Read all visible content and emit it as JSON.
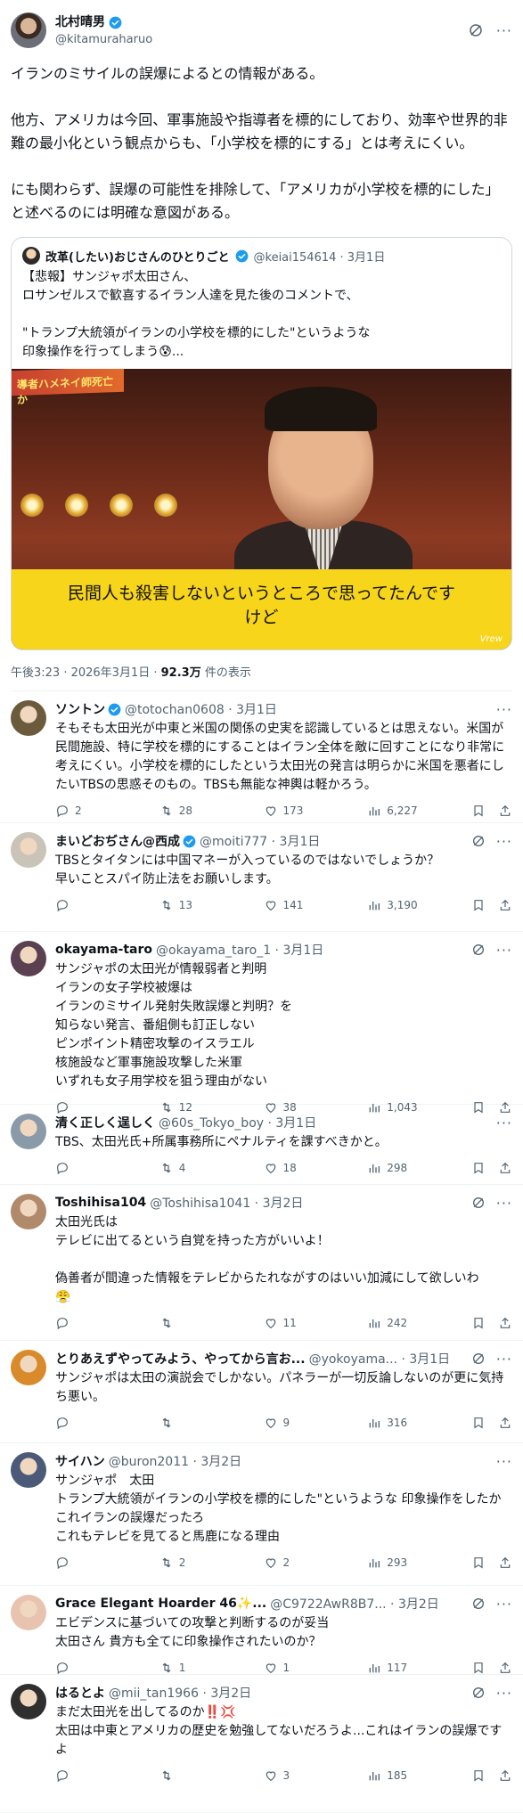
{
  "main": {
    "name": "北村晴男",
    "handle": "@kitamuraharuo",
    "text": [
      "イランのミサイルの誤爆によるとの情報がある。",
      "他方、アメリカは今回、軍事施設や指導者を標的にしており、効率や世界的非難の最小化という観点からも、「小学校を標的にする」とは考えにくい。",
      "にも関わらず、誤爆の可能性を排除して、「アメリカが小学校を標的にした」と述べるのには明確な意図がある。"
    ],
    "timestamp": "午後3:23 · 2026年3月1日 · ",
    "views": "92.3万",
    "views_label": " 件の表示"
  },
  "quote": {
    "name": "改革(したい)おじさんのひとりごと",
    "handle": "@keiai154614 · 3月1日",
    "text": "【悲報】サンジャポ太田さん、\nロサンゼルスで歓喜するイラン人達を見た後のコメントで、\n\n\"トランプ大統領がイランの小学校を標的にした\"というような\n印象操作を行ってしまう😰...",
    "banner": "導者ハメネイ師死亡か",
    "caption": "民間人も殺害しないというところで思ってたんです\nけど",
    "watermark": "Vrew"
  },
  "replies": [
    {
      "name": "ソントン",
      "meta": "@totochan0608 · 3月1日",
      "verified": true,
      "grok": false,
      "text": "そもそも太田光が中東と米国の関係の史実を認識しているとは思えない。米国が民間施設、特に学校を標的にすることはイラン全体を敵に回すことになり非常に考えにくい。小学校を標的にしたという太田光の発言は明らかに米国を悪者にしたいTBSの思惑そのもの。TBSも無能な神輿は軽かろう。",
      "replies": "2",
      "retweets": "28",
      "likes": "173",
      "views": "6,227",
      "avatar_color": "#6b5a3c"
    },
    {
      "name": "まいどおぢさん@西成",
      "meta": "@moiti777 · 3月1日",
      "verified": true,
      "grok": true,
      "text": "TBSとタイタンには中国マネーが入っているのではないでしょうか？\n早いことスパイ防止法をお願いします。",
      "replies": "",
      "retweets": "13",
      "likes": "141",
      "views": "3,190",
      "avatar_color": "#c9c3b8"
    },
    {
      "name": "okayama-taro",
      "meta": "@okayama_taro_1 · 3月1日",
      "verified": false,
      "grok": true,
      "text": "サンジャポの太田光が情報弱者と判明\nイランの女子学校被爆は\nイランのミサイル発射失敗誤爆と判明？を\n知らない発言、番組側も訂正しない\nピンポイント精密攻撃のイスラエル\n核施設など軍事施設攻撃した米軍\nいずれも女子用学校を狙う理由がない",
      "replies": "",
      "retweets": "12",
      "likes": "38",
      "views": "1,043",
      "avatar_color": "#5a4050"
    },
    {
      "name": "清く正しく逞しく",
      "meta": "@60s_Tokyo_boy · 3月1日",
      "verified": false,
      "grok": false,
      "text": "TBS、太田光氏+所属事務所にペナルティを課すべきかと。",
      "replies": "",
      "retweets": "4",
      "likes": "18",
      "views": "298",
      "avatar_color": "#8a9aa8"
    },
    {
      "name": "Toshihisa104",
      "meta": "@Toshihisa1041 · 3月2日",
      "verified": false,
      "grok": true,
      "text": "太田光氏は\nテレビに出てるという自覚を持った方がいいよ！\n\n偽善者が間違った情報をテレビからたれながすのはいい加減にして欲しいわ\n😤",
      "replies": "",
      "retweets": "",
      "likes": "11",
      "views": "242",
      "avatar_color": "#b08a6a"
    },
    {
      "name": "とりあえずやってみよう、やってから言お...",
      "meta": "@yokoyama... · 3月1日",
      "verified": false,
      "grok": true,
      "text": "サンジャポは太田の演説会でしかない。パネラーが一切反論しないのが更に気持ち悪い。",
      "replies": "",
      "retweets": "",
      "likes": "9",
      "views": "316",
      "avatar_color": "#d98a2a"
    },
    {
      "name": "サイハン",
      "meta": "@buron2011 · 3月2日",
      "verified": false,
      "grok": false,
      "text": "サンジャポ　太田\nトランプ大統領がイランの小学校を標的にした\"というような 印象操作をしたか\nこれイランの誤爆だったろ\nこれもテレビを見てると馬鹿になる理由",
      "replies": "",
      "retweets": "2",
      "likes": "2",
      "views": "293",
      "avatar_color": "#4a5a78"
    },
    {
      "name": "Grace Elegant Hoarder 46✨...",
      "meta": "@C9722AwR8B7... · 3月2日",
      "verified": false,
      "grok": true,
      "text": "エビデンスに基づいての攻撃と判断するのが妥当\n太田さん 貴方も全てに印象操作されたいのか？",
      "replies": "",
      "retweets": "1",
      "likes": "1",
      "views": "117",
      "avatar_color": "#e8c4b0"
    },
    {
      "name": "はるとよ",
      "meta": "@mii_tan1966 · 3月2日",
      "verified": false,
      "grok": true,
      "text": "まだ太田光を出してるのか‼️💢\n太田は中東とアメリカの歴史を勉強してないだろうよ...これはイランの誤爆ですよ",
      "replies": "",
      "retweets": "",
      "likes": "3",
      "views": "185",
      "avatar_color": "#2f2f2f"
    }
  ],
  "colors": {
    "verified": "#1d9bf0",
    "text": "#0f1419",
    "muted": "#536471",
    "caption": "#f7d51a"
  }
}
